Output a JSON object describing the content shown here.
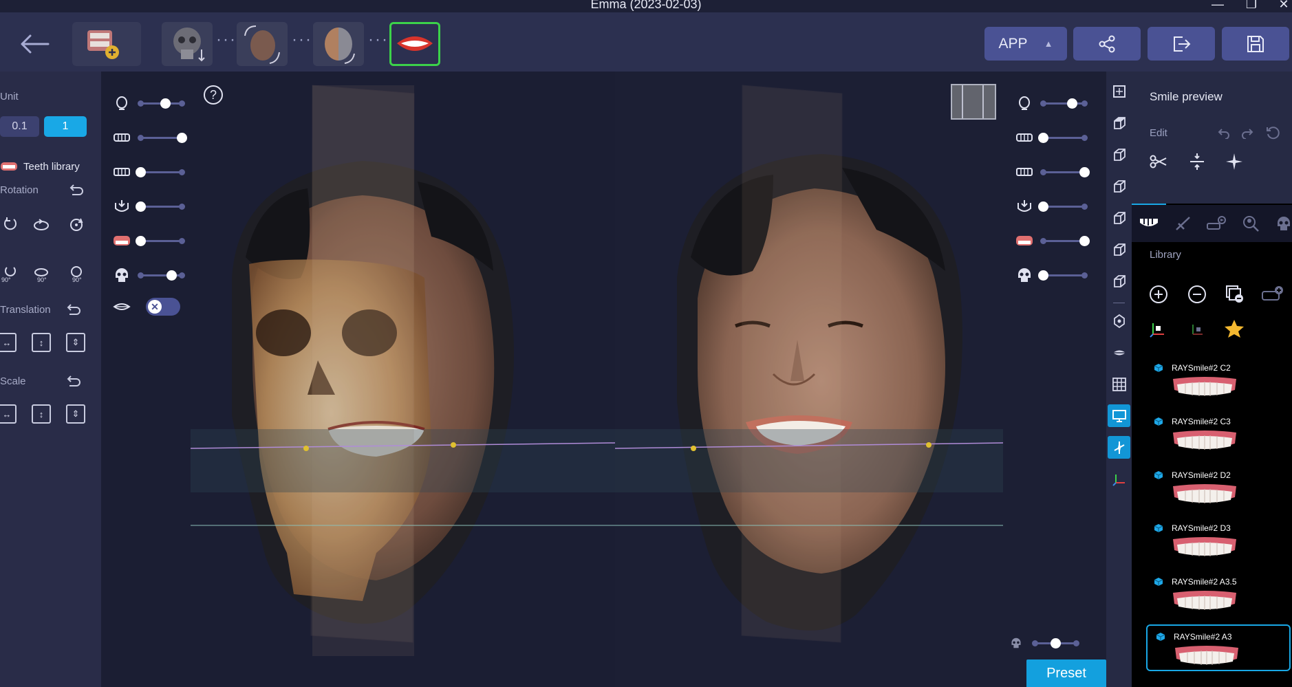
{
  "window": {
    "title": "Emma (2023-02-03)",
    "minimize": "—",
    "maximize": "❐",
    "close": "✕"
  },
  "toolbar": {
    "app_label": "APP",
    "app_caret": "▲",
    "dots": "···",
    "icons": [
      "back-arrow-icon",
      "add-model-icon",
      "skull-align-icon",
      "face-scan-icon",
      "face-skull-icon",
      "smile-lips-icon",
      "share-icon",
      "export-icon",
      "save-icon"
    ]
  },
  "left_panel": {
    "unit_label": "Unit",
    "unit_options": [
      "0.1",
      "1"
    ],
    "unit_selected": "1",
    "teeth_library_label": "Teeth library",
    "rotation_label": "Rotation",
    "rotation_sub": [
      "90°",
      "90°",
      "90°"
    ],
    "translation_label": "Translation",
    "scale_label": "Scale"
  },
  "viewport_left": {
    "help": "?",
    "sliders": [
      {
        "icon": "face-icon",
        "value": 0.6
      },
      {
        "icon": "upper-teeth-icon",
        "value": 1.0
      },
      {
        "icon": "lower-teeth-icon",
        "value": 0.0
      },
      {
        "icon": "jaw-icon",
        "value": 0.0
      },
      {
        "icon": "gum-icon",
        "value": 0.0
      },
      {
        "icon": "skull-icon",
        "value": 0.75
      }
    ],
    "lips_toggle": "✕"
  },
  "viewport_right": {
    "sliders": [
      {
        "icon": "face-icon",
        "value": 0.7
      },
      {
        "icon": "upper-teeth-icon",
        "value": 0.0
      },
      {
        "icon": "lower-teeth-icon",
        "value": 1.0
      },
      {
        "icon": "jaw-icon",
        "value": 0.0
      },
      {
        "icon": "gum-icon",
        "value": 1.0
      },
      {
        "icon": "skull-icon",
        "value": 0.0
      }
    ],
    "bottom_slider": {
      "icon": "skull-icon",
      "value": 0.5
    },
    "preset_label": "Preset"
  },
  "right_panel": {
    "title": "Smile preview",
    "edit_label": "Edit",
    "library_label": "Library",
    "library_items": [
      {
        "name": "RAYSmile#2 C2",
        "selected": false
      },
      {
        "name": "RAYSmile#2 C3",
        "selected": false
      },
      {
        "name": "RAYSmile#2 D2",
        "selected": false
      },
      {
        "name": "RAYSmile#2 D3",
        "selected": false
      },
      {
        "name": "RAYSmile#2 A3.5",
        "selected": false
      },
      {
        "name": "RAYSmile#2 A3",
        "selected": true
      }
    ]
  },
  "colors": {
    "accent": "#19a8e6",
    "toolbar_button": "#4a5294",
    "active_stage_border": "#3cd24a"
  }
}
